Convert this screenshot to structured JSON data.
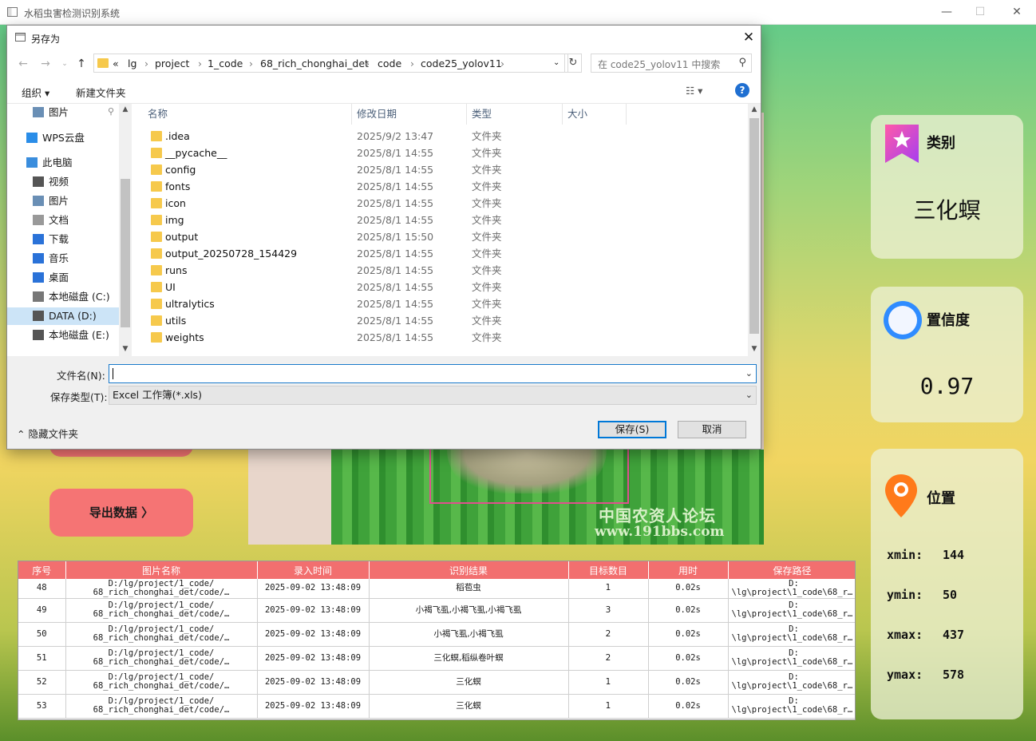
{
  "window": {
    "title": "水稻虫害检测识别系统"
  },
  "cards": {
    "category": {
      "label": "类别",
      "value": "三化螟"
    },
    "confidence": {
      "label": "置信度",
      "value": "0.97"
    },
    "position": {
      "label": "位置",
      "xmin_label": "xmin:",
      "xmin": "144",
      "ymin_label": "ymin:",
      "ymin": "50",
      "xmax_label": "xmax:",
      "xmax": "437",
      "ymax_label": "ymax:",
      "ymax": "578"
    }
  },
  "image": {
    "watermark1": "中国农资人论坛",
    "watermark2": "www.191bbs.com"
  },
  "buttons": {
    "export": "导出数据 〉"
  },
  "table": {
    "headers": [
      "序号",
      "图片名称",
      "录入时间",
      "识别结果",
      "目标数目",
      "用时",
      "保存路径"
    ],
    "rows": [
      {
        "idx": "48",
        "name1": "D:/lg/project/1_code/",
        "name2": "68_rich_chonghai_det/code/…",
        "time": "2025-09-02 13:48:09",
        "result": "稻苞虫",
        "count": "1",
        "dur": "0.02s",
        "path1": "D:",
        "path2": "\\lg\\project\\1_code\\68_r…"
      },
      {
        "idx": "49",
        "name1": "D:/lg/project/1_code/",
        "name2": "68_rich_chonghai_det/code/…",
        "time": "2025-09-02 13:48:09",
        "result": "小褐飞虱,小褐飞虱,小褐飞虱",
        "count": "3",
        "dur": "0.02s",
        "path1": "D:",
        "path2": "\\lg\\project\\1_code\\68_r…"
      },
      {
        "idx": "50",
        "name1": "D:/lg/project/1_code/",
        "name2": "68_rich_chonghai_det/code/…",
        "time": "2025-09-02 13:48:09",
        "result": "小褐飞虱,小褐飞虱",
        "count": "2",
        "dur": "0.02s",
        "path1": "D:",
        "path2": "\\lg\\project\\1_code\\68_r…"
      },
      {
        "idx": "51",
        "name1": "D:/lg/project/1_code/",
        "name2": "68_rich_chonghai_det/code/…",
        "time": "2025-09-02 13:48:09",
        "result": "三化螟,稻纵卷叶螟",
        "count": "2",
        "dur": "0.02s",
        "path1": "D:",
        "path2": "\\lg\\project\\1_code\\68_r…"
      },
      {
        "idx": "52",
        "name1": "D:/lg/project/1_code/",
        "name2": "68_rich_chonghai_det/code/…",
        "time": "2025-09-02 13:48:09",
        "result": "三化螟",
        "count": "1",
        "dur": "0.02s",
        "path1": "D:",
        "path2": "\\lg\\project\\1_code\\68_r…"
      },
      {
        "idx": "53",
        "name1": "D:/lg/project/1_code/",
        "name2": "68_rich_chonghai_det/code/…",
        "time": "2025-09-02 13:48:09",
        "result": "三化螟",
        "count": "1",
        "dur": "0.02s",
        "path1": "D:",
        "path2": "\\lg\\project\\1_code\\68_r…"
      }
    ]
  },
  "dialog": {
    "title": "另存为",
    "crumbs": [
      "«",
      "lg",
      "project",
      "1_code",
      "68_rich_chonghai_det",
      "code",
      "code25_yolov11"
    ],
    "search_placeholder": "在 code25_yolov11 中搜索",
    "organize": "组织 ▾",
    "new_folder": "新建文件夹",
    "sidebar": [
      "图片",
      "WPS云盘",
      "此电脑",
      "视频",
      "图片",
      "文档",
      "下载",
      "音乐",
      "桌面",
      "本地磁盘 (C:)",
      "DATA (D:)",
      "本地磁盘 (E:)"
    ],
    "columns": {
      "name": "名称",
      "date": "修改日期",
      "type": "类型",
      "size": "大小"
    },
    "files": [
      {
        "name": ".idea",
        "date": "2025/9/2 13:47",
        "type": "文件夹"
      },
      {
        "name": "__pycache__",
        "date": "2025/8/1 14:55",
        "type": "文件夹"
      },
      {
        "name": "config",
        "date": "2025/8/1 14:55",
        "type": "文件夹"
      },
      {
        "name": "fonts",
        "date": "2025/8/1 14:55",
        "type": "文件夹"
      },
      {
        "name": "icon",
        "date": "2025/8/1 14:55",
        "type": "文件夹"
      },
      {
        "name": "img",
        "date": "2025/8/1 14:55",
        "type": "文件夹"
      },
      {
        "name": "output",
        "date": "2025/8/1 15:50",
        "type": "文件夹"
      },
      {
        "name": "output_20250728_154429",
        "date": "2025/8/1 14:55",
        "type": "文件夹"
      },
      {
        "name": "runs",
        "date": "2025/8/1 14:55",
        "type": "文件夹"
      },
      {
        "name": "UI",
        "date": "2025/8/1 14:55",
        "type": "文件夹"
      },
      {
        "name": "ultralytics",
        "date": "2025/8/1 14:55",
        "type": "文件夹"
      },
      {
        "name": "utils",
        "date": "2025/8/1 14:55",
        "type": "文件夹"
      },
      {
        "name": "weights",
        "date": "2025/8/1 14:55",
        "type": "文件夹"
      }
    ],
    "filename_label": "文件名(N):",
    "filename_value": "",
    "filetype_label": "保存类型(T):",
    "filetype_value": "Excel 工作簿(*.xls)",
    "hide_folders": "隐藏文件夹",
    "save": "保存(S)",
    "cancel": "取消"
  }
}
